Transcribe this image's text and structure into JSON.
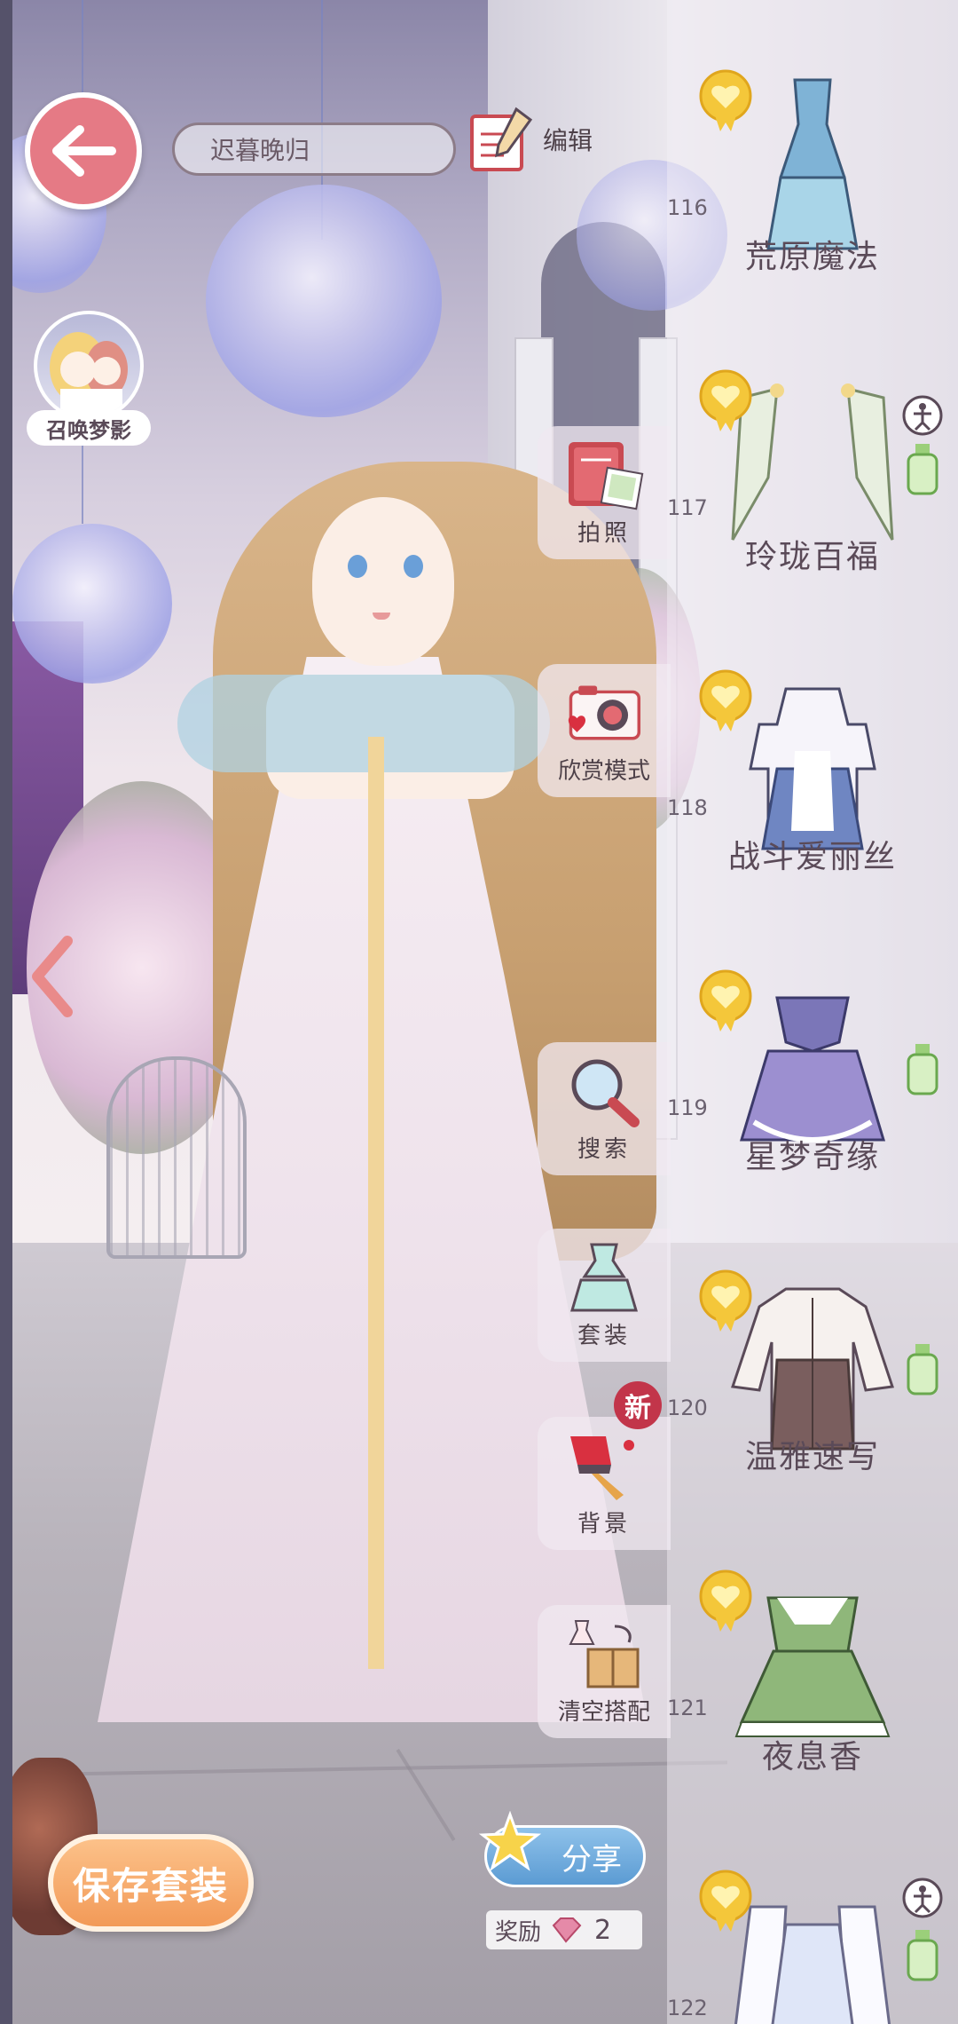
{
  "header": {
    "outfit_name": "迟暮晚归",
    "edit_label": "编辑"
  },
  "summon": {
    "label": "召唤梦影"
  },
  "tools": [
    {
      "label": "拍照"
    },
    {
      "label": "欣赏模式"
    },
    {
      "label": "搜索"
    },
    {
      "label": "套装"
    },
    {
      "label": "背景",
      "badge": "新"
    },
    {
      "label": "清空搭配"
    }
  ],
  "bottom": {
    "save_label": "保存套装",
    "share_label": "分享",
    "reward_label": "奖励",
    "reward_count": "2"
  },
  "outfits": [
    {
      "num": "116",
      "name": "荒原魔法",
      "icon": "blue-dress-icon"
    },
    {
      "num": "117",
      "name": "玲珑百福",
      "icon": "ribbon-sleeves-icon"
    },
    {
      "num": "118",
      "name": "战斗爱丽丝",
      "icon": "maid-dress-icon"
    },
    {
      "num": "119",
      "name": "星梦奇缘",
      "icon": "purple-dress-icon"
    },
    {
      "num": "120",
      "name": "温雅速写",
      "icon": "coat-dress-icon"
    },
    {
      "num": "121",
      "name": "夜息香",
      "icon": "green-dress-icon"
    },
    {
      "num": "122",
      "name": "",
      "icon": "white-dress-icon"
    }
  ],
  "colors": {
    "accent": "#e57a85",
    "save": "#f29a58",
    "share": "#5b9bd3",
    "badge": "#c2354a"
  }
}
